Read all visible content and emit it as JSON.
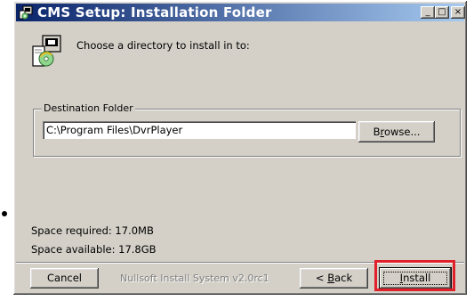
{
  "window": {
    "title": "CMS Setup: Installation Folder",
    "controls": [
      "_",
      "□",
      "×"
    ]
  },
  "header": {
    "text": "Choose a directory to install in to:"
  },
  "destination": {
    "legend": "Destination Folder",
    "value": "C:\\Program Files\\DvrPlayer",
    "browse_label_pre": "B",
    "browse_label_u": "r",
    "browse_label_post": "owse..."
  },
  "space": {
    "required": "Space required: 17.0MB",
    "available": "Space available: 17.8GB"
  },
  "footer": {
    "cancel_label": "Cancel",
    "branding": "Nullsoft Install System v2.0rc1",
    "back_pre": "< ",
    "back_u": "B",
    "back_post": "ack",
    "install_u": "I",
    "install_post": "nstall"
  },
  "colors": {
    "title_gradient_start": "#0a246a",
    "title_gradient_end": "#a6caf0",
    "dialog_face": "#d4d0c8",
    "highlight": "#e0202a"
  }
}
